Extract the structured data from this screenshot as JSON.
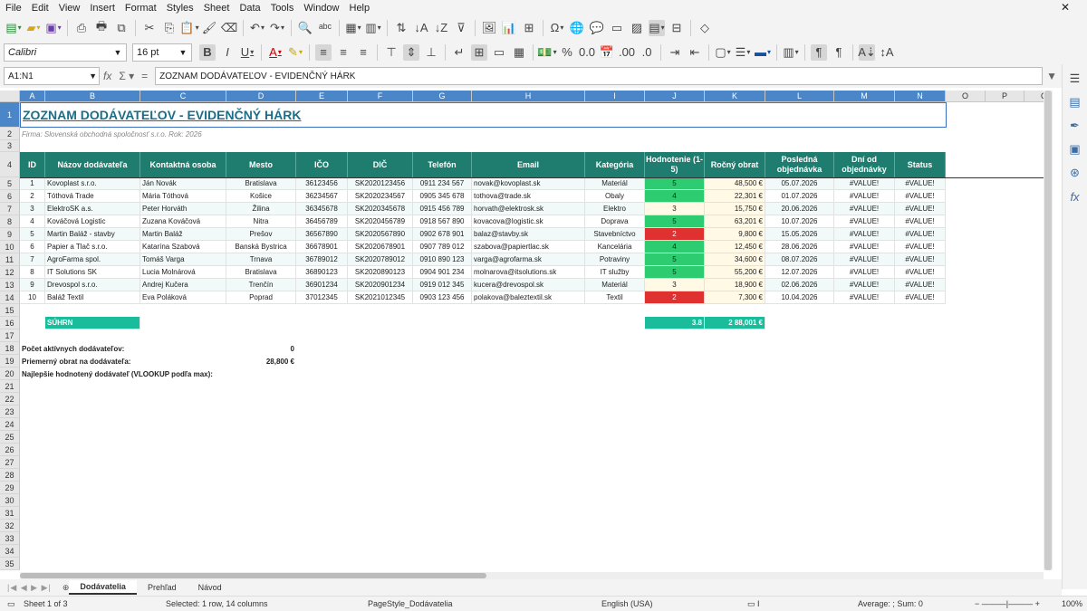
{
  "menu": [
    "File",
    "Edit",
    "View",
    "Insert",
    "Format",
    "Styles",
    "Sheet",
    "Data",
    "Tools",
    "Window",
    "Help"
  ],
  "font": {
    "name": "Calibri",
    "size": "16 pt"
  },
  "namebox": "A1:N1",
  "formula": "ZOZNAM DODÁVATEĽOV - EVIDENČNÝ HÁRK",
  "columns": [
    "A",
    "B",
    "C",
    "D",
    "E",
    "F",
    "G",
    "H",
    "I",
    "J",
    "K",
    "L",
    "M",
    "N",
    "O",
    "P",
    "Q"
  ],
  "rows": [
    "1",
    "2",
    "3",
    "4",
    "5",
    "6",
    "7",
    "8",
    "9",
    "10",
    "11",
    "12",
    "13",
    "14",
    "15",
    "16",
    "17",
    "18",
    "19",
    "20",
    "21",
    "22",
    "23",
    "24",
    "25",
    "26",
    "27",
    "28",
    "29",
    "30",
    "31",
    "32",
    "33",
    "34",
    "35"
  ],
  "title": "ZOZNAM DODÁVATEĽOV - EVIDENČNÝ HÁRK",
  "subtitle": "Firma: Slovenská obchodná spoločnosť s.r.o.    Rok: 2026",
  "headers": [
    "ID",
    "Názov dodávateľa",
    "Kontaktná osoba",
    "Mesto",
    "IČO",
    "DIČ",
    "Telefón",
    "Email",
    "Kategória",
    "Hodnotenie (1-5)",
    "Ročný obrat",
    "Posledná objednávka",
    "Dní od objednávky",
    "Status"
  ],
  "table": [
    [
      "1",
      "Kovoplast s.r.o.",
      "Ján Novák",
      "Bratislava",
      "36123456",
      "SK2020123456",
      "0911 234 567",
      "novak@kovoplast.sk",
      "Materiál",
      "5",
      "48,500 €",
      "05.07.2026",
      "#VALUE!",
      "#VALUE!"
    ],
    [
      "2",
      "Tóthová Trade",
      "Mária Tóthová",
      "Košice",
      "36234567",
      "SK2020234567",
      "0905 345 678",
      "tothova@trade.sk",
      "Obaly",
      "4",
      "22,301 €",
      "01.07.2026",
      "#VALUE!",
      "#VALUE!"
    ],
    [
      "3",
      "ElektroSK a.s.",
      "Peter Horváth",
      "Žilina",
      "36345678",
      "SK2020345678",
      "0915 456 789",
      "horvath@elektrosk.sk",
      "Elektro",
      "3",
      "15,750 €",
      "20.06.2026",
      "#VALUE!",
      "#VALUE!"
    ],
    [
      "4",
      "Kováčová Logistic",
      "Zuzana Kováčová",
      "Nitra",
      "36456789",
      "SK2020456789",
      "0918 567 890",
      "kovacova@logistic.sk",
      "Doprava",
      "5",
      "63,201 €",
      "10.07.2026",
      "#VALUE!",
      "#VALUE!"
    ],
    [
      "5",
      "Martin Baláž - stavby",
      "Martin Baláž",
      "Prešov",
      "36567890",
      "SK2020567890",
      "0902 678 901",
      "balaz@stavby.sk",
      "Stavebníctvo",
      "2",
      "9,800 €",
      "15.05.2026",
      "#VALUE!",
      "#VALUE!"
    ],
    [
      "6",
      "Papier a Tlač s.r.o.",
      "Katarína Szabová",
      "Banská Bystrica",
      "36678901",
      "SK2020678901",
      "0907 789 012",
      "szabova@papiertlac.sk",
      "Kancelária",
      "4",
      "12,450 €",
      "28.06.2026",
      "#VALUE!",
      "#VALUE!"
    ],
    [
      "7",
      "AgroFarma spol.",
      "Tomáš Varga",
      "Trnava",
      "36789012",
      "SK2020789012",
      "0910 890 123",
      "varga@agrofarma.sk",
      "Potraviny",
      "5",
      "34,600 €",
      "08.07.2026",
      "#VALUE!",
      "#VALUE!"
    ],
    [
      "8",
      "IT Solutions SK",
      "Lucia Molnárová",
      "Bratislava",
      "36890123",
      "SK2020890123",
      "0904 901 234",
      "molnarova@itsolutions.sk",
      "IT služby",
      "5",
      "55,200 €",
      "12.07.2026",
      "#VALUE!",
      "#VALUE!"
    ],
    [
      "9",
      "Drevospol s.r.o.",
      "Andrej Kučera",
      "Trenčín",
      "36901234",
      "SK2020901234",
      "0919 012 345",
      "kucera@drevospol.sk",
      "Materiál",
      "3",
      "18,900 €",
      "02.06.2026",
      "#VALUE!",
      "#VALUE!"
    ],
    [
      "10",
      "Baláž Textil",
      "Eva Poláková",
      "Poprad",
      "37012345",
      "SK2021012345",
      "0903 123 456",
      "polakova@baleztextil.sk",
      "Textil",
      "2",
      "7,300 €",
      "10.04.2026",
      "#VALUE!",
      "#VALUE!"
    ]
  ],
  "summary": {
    "label": "SÚHRN",
    "avg": "3.8",
    "total": "2 88,001 €"
  },
  "stats": [
    {
      "label": "Počet aktívnych dodávateľov:",
      "value": "0"
    },
    {
      "label": "Priemerný obrat na dodávateľa:",
      "value": "28,800 €"
    },
    {
      "label": "Najlepšie hodnotený dodávateľ (VLOOKUP podľa max):",
      "value": ""
    }
  ],
  "tabs": [
    "Dodávatelia",
    "Prehľad",
    "Návod"
  ],
  "status": {
    "sheet": "Sheet 1 of 3",
    "selection": "Selected: 1 row, 14 columns",
    "style": "PageStyle_Dodávatelia",
    "lang": "English (USA)",
    "sum": "Average: ; Sum: 0",
    "zoom": "100%"
  },
  "colors": {
    "header": "#1e7d6e",
    "accent": "#1abc9c",
    "green": "#2ecc71",
    "red": "#e03131",
    "yellow": "#fff9e6",
    "title": "#1a6e8a"
  }
}
